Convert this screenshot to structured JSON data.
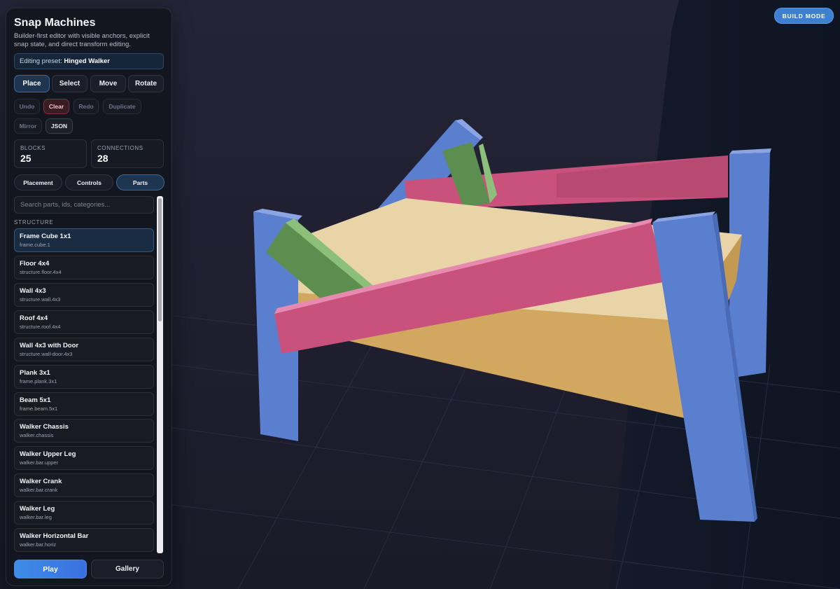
{
  "app": {
    "title": "Snap Machines",
    "subtitle": "Builder-first editor with visible anchors, explicit snap state, and direct transform editing."
  },
  "preset": {
    "label": "Editing preset:",
    "name": "Hinged Walker"
  },
  "modes": [
    "Place",
    "Select",
    "Move",
    "Rotate"
  ],
  "actions": {
    "undo": "Undo",
    "clear": "Clear",
    "redo": "Redo",
    "duplicate": "Duplicate",
    "mirror": "Mirror",
    "json": "JSON"
  },
  "stats": {
    "blocks_label": "BLOCKS",
    "blocks_value": "25",
    "connections_label": "CONNECTIONS",
    "connections_value": "28"
  },
  "tabs": [
    "Placement",
    "Controls",
    "Parts"
  ],
  "search": {
    "placeholder": "Search parts, ids, categories..."
  },
  "section": "STRUCTURE",
  "parts": [
    {
      "name": "Frame Cube 1x1",
      "id": "frame.cube.1"
    },
    {
      "name": "Floor 4x4",
      "id": "structure.floor.4x4"
    },
    {
      "name": "Wall 4x3",
      "id": "structure.wall.4x3"
    },
    {
      "name": "Roof 4x4",
      "id": "structure.roof.4x4"
    },
    {
      "name": "Wall 4x3 with Door",
      "id": "structure.wall-door.4x3"
    },
    {
      "name": "Plank 3x1",
      "id": "frame.plank.3x1"
    },
    {
      "name": "Beam 5x1",
      "id": "frame.beam.5x1"
    },
    {
      "name": "Walker Chassis",
      "id": "walker.chassis"
    },
    {
      "name": "Walker Upper Leg",
      "id": "walker.bar.upper"
    },
    {
      "name": "Walker Crank",
      "id": "walker.bar.crank"
    },
    {
      "name": "Walker Leg",
      "id": "walker.bar.leg"
    },
    {
      "name": "Walker Horizontal Bar",
      "id": "walker.bar.horiz"
    }
  ],
  "footer": {
    "play": "Play",
    "gallery": "Gallery"
  },
  "badge": "BUILD MODE",
  "colors": {
    "accent": "#3d7fd1",
    "leg_blue": "#5b7fcf",
    "bar_pink": "#c9527d",
    "link_green": "#5c8f4f",
    "deck_tan": "#e8d4a6"
  }
}
